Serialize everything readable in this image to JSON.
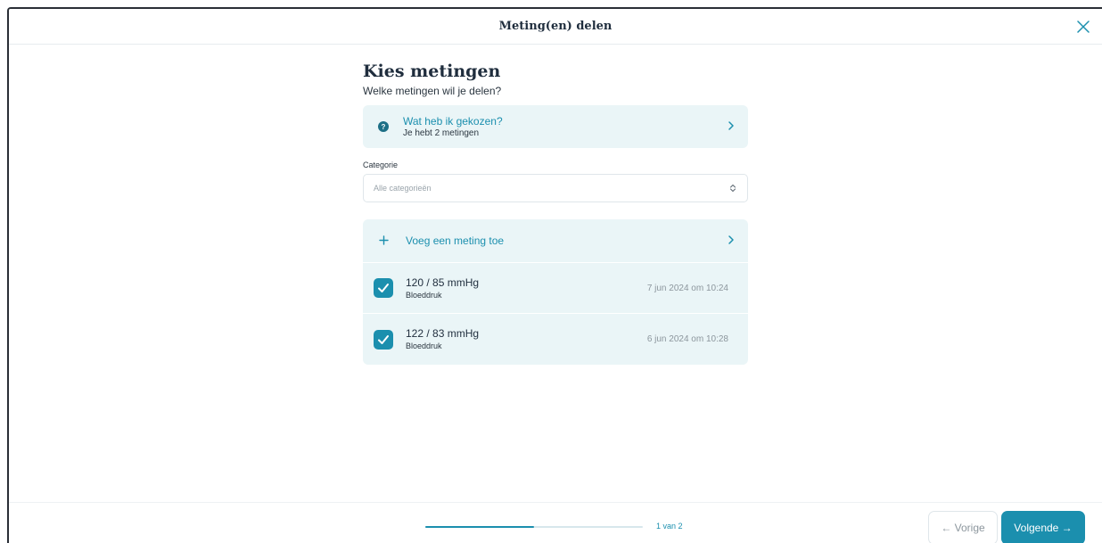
{
  "header": {
    "title": "Meting(en) delen"
  },
  "main": {
    "title": "Kies metingen",
    "subtitle": "Welke metingen wil je delen?",
    "selection_card": {
      "title": "Wat heb ik gekozen?",
      "subtitle": "Je hebt 2 metingen",
      "icon": "question-icon"
    },
    "category": {
      "label": "Categorie",
      "value": "Alle categorieën"
    },
    "add_measurement_label": "Voeg een meting toe",
    "measurements": [
      {
        "value": "120 / 85 mmHg",
        "type": "Bloeddruk",
        "date": "7 jun 2024 om 10:24",
        "checked": true
      },
      {
        "value": "122 / 83 mmHg",
        "type": "Bloeddruk",
        "date": "6 jun 2024 om 10:28",
        "checked": true
      }
    ]
  },
  "footer": {
    "progress_text": "1 van 2",
    "progress_fraction": 0.5,
    "prev_label": "← Vorige",
    "next_label": "Volgende →"
  },
  "colors": {
    "accent": "#1b8fae",
    "card_background": "#eaf5f7"
  }
}
